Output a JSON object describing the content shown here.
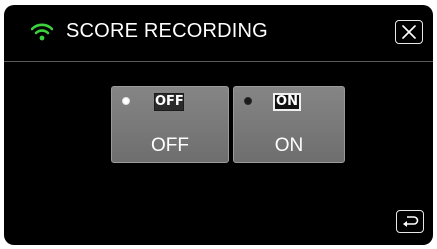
{
  "header": {
    "title": "SCORE RECORDING",
    "wifi_icon": "wifi-icon",
    "close_icon": "close-icon"
  },
  "options": [
    {
      "badge": "OFF",
      "label": "OFF",
      "selected": false
    },
    {
      "badge": "ON",
      "label": "ON",
      "selected": false
    }
  ],
  "footer": {
    "back_icon": "return-arrow-icon"
  },
  "colors": {
    "background": "#000000",
    "wifi": "#3dd13d",
    "option_fill": "#7a7a7a",
    "text": "#ffffff"
  }
}
